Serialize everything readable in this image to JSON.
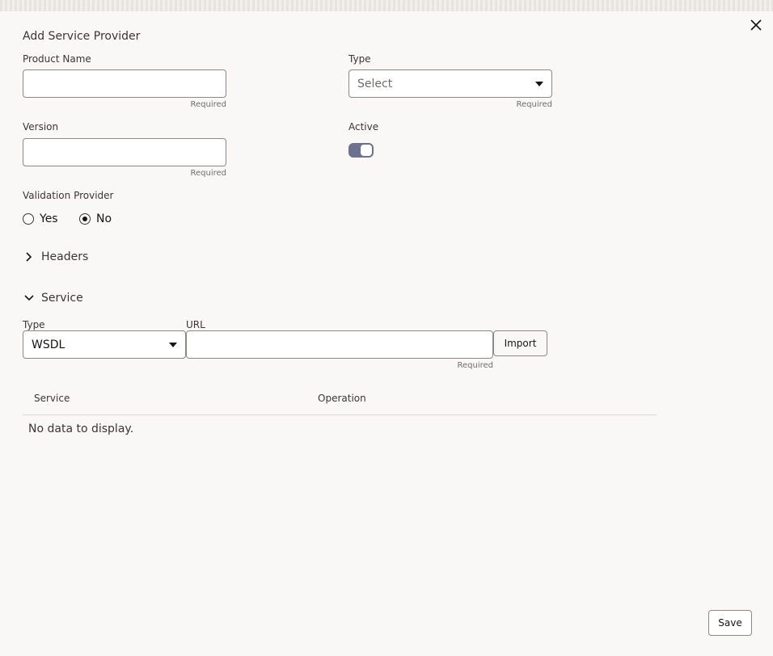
{
  "dialog": {
    "title": "Add Service Provider",
    "close_icon": "close-icon"
  },
  "form": {
    "product_name": {
      "label": "Product Name",
      "value": "",
      "helper": "Required"
    },
    "type": {
      "label": "Type",
      "placeholder": "Select",
      "helper": "Required"
    },
    "version": {
      "label": "Version",
      "value": "",
      "helper": "Required"
    },
    "active": {
      "label": "Active",
      "on": true
    },
    "validation_provider": {
      "label": "Validation Provider",
      "options": [
        "Yes",
        "No"
      ],
      "selected": "No"
    }
  },
  "sections": {
    "headers": {
      "label": "Headers",
      "expanded": false
    },
    "service": {
      "label": "Service",
      "expanded": true
    }
  },
  "service": {
    "type": {
      "label": "Type",
      "value": "WSDL"
    },
    "url": {
      "label": "URL",
      "value": "",
      "helper": "Required"
    },
    "import_label": "Import",
    "table": {
      "columns": [
        "Service",
        "Operation"
      ],
      "empty_text": "No data to display."
    }
  },
  "footer": {
    "save_label": "Save"
  },
  "colors": {
    "toggle_on": "#6c7190",
    "background": "#f9f8f6"
  }
}
